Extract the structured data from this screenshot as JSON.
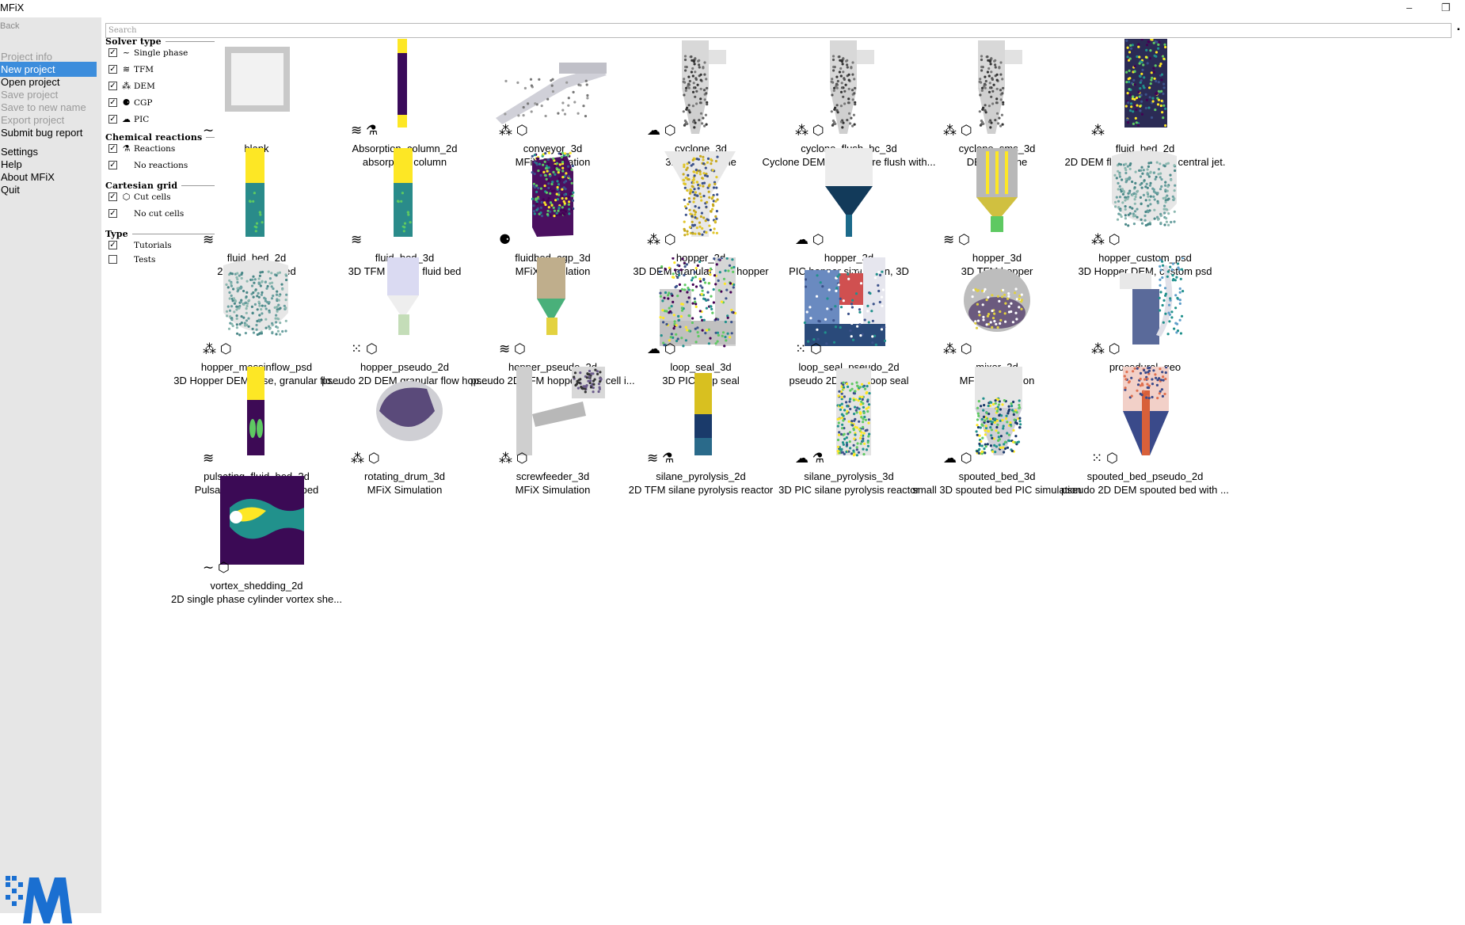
{
  "window": {
    "title": "MFiX",
    "minimize": "–",
    "restore": "❐"
  },
  "sidebar": {
    "back": "Back",
    "items": [
      {
        "label": "Project info",
        "state": "disabled"
      },
      {
        "label": "New project",
        "state": "active"
      },
      {
        "label": "Open project",
        "state": "normal"
      },
      {
        "label": "Save project",
        "state": "disabled"
      },
      {
        "label": "Save to new name",
        "state": "disabled"
      },
      {
        "label": "Export project",
        "state": "disabled"
      },
      {
        "label": "Submit bug report",
        "state": "normal"
      },
      {
        "label": "Settings",
        "state": "normal"
      },
      {
        "label": "Help",
        "state": "normal"
      },
      {
        "label": "About MFiX",
        "state": "normal"
      },
      {
        "label": "Quit",
        "state": "normal"
      }
    ]
  },
  "search": {
    "placeholder": "Search",
    "value": ""
  },
  "filters": {
    "sections": [
      {
        "title": "Solver type",
        "options": [
          {
            "label": "Single phase",
            "checked": true,
            "icon": "~"
          },
          {
            "label": "TFM",
            "checked": true,
            "icon": "≋"
          },
          {
            "label": "DEM",
            "checked": true,
            "icon": "⁂"
          },
          {
            "label": "CGP",
            "checked": true,
            "icon": "⚈"
          },
          {
            "label": "PIC",
            "checked": true,
            "icon": "☁"
          }
        ]
      },
      {
        "title": "Chemical reactions",
        "options": [
          {
            "label": "Reactions",
            "checked": true,
            "icon": "⚗"
          },
          {
            "label": "No reactions",
            "checked": true,
            "icon": ""
          }
        ]
      },
      {
        "title": "Cartesian grid",
        "options": [
          {
            "label": "Cut cells",
            "checked": true,
            "icon": "⬡"
          },
          {
            "label": "No cut cells",
            "checked": true,
            "icon": ""
          }
        ]
      },
      {
        "title": "Type",
        "options": [
          {
            "label": "Tutorials",
            "checked": true,
            "icon": ""
          },
          {
            "label": "Tests",
            "checked": false,
            "icon": ""
          }
        ]
      }
    ]
  },
  "templates": [
    {
      "name": "blank",
      "desc": "",
      "badges": "∼",
      "art": "blank"
    },
    {
      "name": "Absorption_column_2d",
      "desc": "absorption column",
      "badges": "≋ ⚗",
      "art": "column"
    },
    {
      "name": "conveyor_3d",
      "desc": "MFiX Simulation",
      "badges": "⁂ ⬡",
      "art": "conveyor"
    },
    {
      "name": "cyclone_3d",
      "desc": "3D PIC cyclone",
      "badges": "☁ ⬡",
      "art": "cyclone"
    },
    {
      "name": "cyclone_flush_bc_3d",
      "desc": "Cyclone DEM, all BCs are flush with...",
      "badges": "⁂ ⬡",
      "art": "cyclone"
    },
    {
      "name": "cyclone_sms_3d",
      "desc": "DEM cyclone",
      "badges": "⁂ ⬡",
      "art": "cyclone"
    },
    {
      "name": "fluid_bed_2d",
      "desc": "2D DEM fluid bed with a central jet.",
      "badges": "⁂",
      "art": "bedjet"
    },
    {
      "name": "fluid_bed_2d",
      "desc": "2D TFM fluid bed",
      "badges": "≋",
      "art": "tfmbed"
    },
    {
      "name": "fluid_bed_3d",
      "desc": "3D TFM square fluid bed",
      "badges": "≋",
      "art": "tfmbed"
    },
    {
      "name": "fluidbed_cgp_3d",
      "desc": "MFiX Simulation",
      "badges": "⚈",
      "art": "cgp"
    },
    {
      "name": "hopper_3d",
      "desc": "3D DEM granular flow hopper",
      "badges": "⁂ ⬡",
      "art": "hopper_y"
    },
    {
      "name": "hopper_3d",
      "desc": "PIC hopper simulation, 3D",
      "badges": "☁ ⬡",
      "art": "hopper_w"
    },
    {
      "name": "hopper_3d",
      "desc": "3D TFM hopper",
      "badges": "≋ ⬡",
      "art": "hopper_tfm"
    },
    {
      "name": "hopper_custom_psd",
      "desc": "3D Hopper DEM, custom psd",
      "badges": "⁂ ⬡",
      "art": "hopper_big"
    },
    {
      "name": "hopper_massinflow_psd",
      "desc": "3D Hopper DEM case, granular flo...",
      "badges": "⁂ ⬡",
      "art": "hopper_big"
    },
    {
      "name": "hopper_pseudo_2d",
      "desc": "pseudo 2D DEM granular flow hop...",
      "badges": "⁙ ⬡",
      "art": "hopper_p"
    },
    {
      "name": "hopper_pseudo_2d",
      "desc": "pseudo 2D TFM hopper (one cell i...",
      "badges": "≋ ⬡",
      "art": "hopper_p2"
    },
    {
      "name": "loop_seal_3d",
      "desc": "3D PIC loop seal",
      "badges": "☁ ⬡",
      "art": "loopseal"
    },
    {
      "name": "loop_seal_pseudo_2d",
      "desc": "pseudo 2D DEM loop seal",
      "badges": "⁙ ⬡",
      "art": "loopseal2"
    },
    {
      "name": "mixer_3d",
      "desc": "MFiX Simulation",
      "badges": "⁂ ⬡",
      "art": "mixer"
    },
    {
      "name": "procedural_geo",
      "desc": "",
      "badges": "⁂ ⬡",
      "art": "proc"
    },
    {
      "name": "pulsating_fluid_bed_2d",
      "desc": "Pulsating 2D TFM fluid bed",
      "badges": "≋",
      "art": "pulse"
    },
    {
      "name": "rotating_drum_3d",
      "desc": "MFiX Simulation",
      "badges": "⁂ ⬡",
      "art": "drum"
    },
    {
      "name": "screwfeeder_3d",
      "desc": "MFiX Simulation",
      "badges": "⁂ ⬡",
      "art": "screw"
    },
    {
      "name": "silane_pyrolysis_2d",
      "desc": "2D TFM silane pyrolysis reactor",
      "badges": "≋ ⚗",
      "art": "silane2d"
    },
    {
      "name": "silane_pyrolysis_3d",
      "desc": "3D PIC silane pyrolysis reactor",
      "badges": "☁ ⚗",
      "art": "silane3d"
    },
    {
      "name": "spouted_bed_3d",
      "desc": "small 3D spouted bed PIC simulation",
      "badges": "☁ ⬡",
      "art": "spout"
    },
    {
      "name": "spouted_bed_pseudo_2d",
      "desc": "pseudo 2D DEM spouted bed with ...",
      "badges": "⁙ ⬡",
      "art": "spout2"
    },
    {
      "name": "vortex_shedding_2d",
      "desc": "2D single phase cylinder vortex she...",
      "badges": "∼ ⬡",
      "art": "vortex"
    }
  ]
}
